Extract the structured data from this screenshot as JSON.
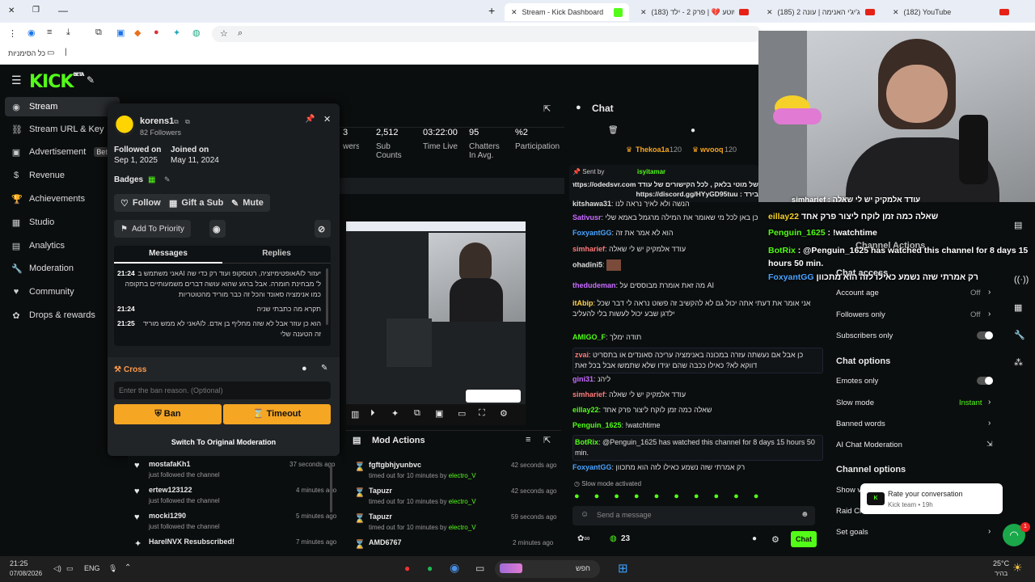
{
  "browser": {
    "tabs": [
      {
        "label": "(182) YouTube"
      },
      {
        "label": "(185) רונן ג'יג'י האנימה | עונה 2"
      },
      {
        "label": "(183) הפשוטע 💔 | פרק 2 - ילד"
      },
      {
        "label": "Stream - Kick Dashboard"
      }
    ],
    "bookmarks_label": "כל הסימניות"
  },
  "sidebar": {
    "items": [
      {
        "label": "Stream",
        "icon": "stream-icon"
      },
      {
        "label": "Stream URL & Key",
        "icon": "link-icon"
      },
      {
        "label": "Advertisement",
        "icon": "ad-icon"
      },
      {
        "label": "Revenue",
        "icon": "revenue-icon"
      },
      {
        "label": "Achievements",
        "icon": "trophy-icon"
      },
      {
        "label": "Studio",
        "icon": "studio-icon"
      },
      {
        "label": "Analytics",
        "icon": "analytics-icon"
      },
      {
        "label": "Moderation",
        "icon": "wrench-icon"
      },
      {
        "label": "Community",
        "icon": "community-icon"
      },
      {
        "label": "Drops & rewards",
        "icon": "gift-icon"
      }
    ],
    "badge": "Bet"
  },
  "stats": [
    {
      "value": "3",
      "label": "wers"
    },
    {
      "value": "2,512",
      "label": "Sub Counts"
    },
    {
      "value": "03:22:00",
      "label": "Time Live"
    },
    {
      "value": "95",
      "label": "Chatters In Avg."
    },
    {
      "value": "%2",
      "label": "Participation"
    }
  ],
  "user_card": {
    "username": "korens1",
    "followers": "82 Followers",
    "followed_on_label": "Followed on",
    "followed_on": "Sep 1, 2025",
    "joined_on_label": "Joined on",
    "joined_on": "May 11, 2024",
    "badges_label": "Badges",
    "follow": "Follow",
    "gift_sub": "Gift a Sub",
    "mute": "Mute",
    "add_priority": "Add To Priority",
    "tab_messages": "Messages",
    "tab_replies": "Replies",
    "messages": [
      {
        "time": "21:24",
        "text": "יעזור לAIאופטימיזציה, רטוסקופ ועוד רק כדי שה AIאני משתמש ב ל' מבחינת חומרה. אבל ברגע שהוא עושה דברים משמעותיים בתקופה כמו אנימציה סאונד והכל זה כבר מוריד מהטוטריות"
      },
      {
        "time": "21:24",
        "text": "תקרא מה כתבתי שניה"
      },
      {
        "time": "21:25",
        "text": "הוא כן עוזר אבל לא שזה מחליף בן אדם. לAIאני לא ממש מוריד זה הטענה שלי"
      }
    ],
    "cross_label": "Cross",
    "ban_reason_placeholder": "Enter the ban reason. (Optional)",
    "ban": "Ban",
    "timeout": "Timeout",
    "switch": "Switch To Original Moderation"
  },
  "recent_events": [
    {
      "name": "mostafaKh1",
      "sub": "just followed the channel",
      "time": "37 seconds ago"
    },
    {
      "name": "ertew123122",
      "sub": "just followed the channel",
      "time": "4 minutes ago"
    },
    {
      "name": "mocki1290",
      "sub": "just followed the channel",
      "time": "5 minutes ago"
    },
    {
      "name": "HarelNVX Resubscribed!",
      "sub": "",
      "time": "7 minutes ago"
    }
  ],
  "mod_actions": {
    "title": "Mod Actions",
    "rows": [
      {
        "name": "fgftgbhjyunbvc",
        "sub": "timed out for 10 minutes by",
        "by": "electro_V",
        "time": "42 seconds ago"
      },
      {
        "name": "Tapuzr",
        "sub": "timed out for 10 minutes by",
        "by": "electro_V",
        "time": "42 seconds ago"
      },
      {
        "name": "Tapuzr",
        "sub": "timed out for 10 minutes by",
        "by": "electro_V",
        "time": "59 seconds ago"
      },
      {
        "name": "AMD6767",
        "sub": "",
        "by": "",
        "time": "2 minutes ago"
      }
    ]
  },
  "chat": {
    "title": "Chat",
    "top_gifters": [
      {
        "name": "Thekoa1a",
        "count": "120"
      },
      {
        "name": "wvooq",
        "count": "120"
      }
    ],
    "pinned": {
      "sent_by": "Sent by",
      "user": "isyitamar",
      "line1": "של מוטי בלאק , לכל הקישורים של עודד https://odedsvr.com/",
      "line2": "בירד : https://discord.gg/HYyGD95tuu"
    },
    "messages": [
      {
        "user": "kitshawa31",
        "text": "הנשה ולא לאיך נראה לנו",
        "color": "#e0e0e0"
      },
      {
        "user": "Sativusr",
        "text": "כן באן לכל מי שאומר את המילה מרגמל באמא שלי",
        "color": "#c86bff"
      },
      {
        "user": "FoxyantGG",
        "text": "הוא לא אמר את זה",
        "color": "#4aa3ff"
      },
      {
        "user": "simharief",
        "text": "עודד אלמקיק יש לי שאלה",
        "color": "#ff7a7a"
      },
      {
        "user": "ohadini5",
        "text": "",
        "color": "#e0e0e0"
      },
      {
        "user": "thedudeman",
        "text": "מה זאת אומרת מבוססים על AI",
        "color": "#c86bff"
      },
      {
        "user": "itAbip",
        "text": "אני אומר את דעתי אתה יכול גם לא להקשיב זה פשוט נראה לי דבר שכל ילדגן שבע יכול לעשות בלי להעליב",
        "color": "#ffd24a"
      },
      {
        "user": "AMIGO_F",
        "text": "תודה ימלך",
        "color": "#53fc18"
      },
      {
        "user": "zvai",
        "text": "כן אבל אם נעשתה עזרה במכונה באנימציה עריכה סאונדים או בתסריט דווקא לא? כאילו ככבה שהם יגידו שלא שתמשו אבל בכל זאת",
        "color": "#ff7a7a"
      },
      {
        "user": "gini31",
        "text": "ליהנ",
        "color": "#c86bff"
      },
      {
        "user": "simharief",
        "text": "עודד אלמקיק יש לי שאלה",
        "color": "#ff7a7a"
      },
      {
        "user": "eillay22",
        "text": "שאלה כמה זמן לוקח ליצור פרק אחד",
        "color": "#53fc18"
      },
      {
        "user": "Penguin_1625",
        "text": "!watchtime",
        "color": "#53fc18"
      },
      {
        "user": "BotRix",
        "text": "@Penguin_1625 has watched this channel for 8 days 15 hours 50 min.",
        "color": "#53fc18"
      },
      {
        "user": "FoxyantGG",
        "text": "רק אמרתי שזה נשמע כאילו לזה הוא מתכוון",
        "color": "#4aa3ff"
      }
    ],
    "slow_mode": "Slow mode activated",
    "placeholder": "Send a message",
    "count": "23",
    "send": "Chat"
  },
  "channel_actions": {
    "title": "Channel Actions",
    "chat_access": "Chat access",
    "account_age": "Account age",
    "account_age_val": "Off",
    "followers_only": "Followers only",
    "followers_only_val": "Off",
    "subscribers_only": "Subscribers only",
    "chat_options": "Chat options",
    "emotes_only": "Emotes only",
    "slow_mode": "Slow mode",
    "slow_mode_val": "Instant",
    "banned_words": "Banned words",
    "ai_moderation": "AI Chat Moderation",
    "channel_options": "Channel options",
    "show_v": "Show v",
    "raid_cha": "Raid Cha",
    "set_goals": "Set goals"
  },
  "overlay": {
    "line1": "עודד אלמקיק יש לי שאלה : simharief",
    "line2a": "eillay22",
    "line2b": "שאלה כמה זמן לוקח ליצור פרק אחד",
    "line3a": "Penguin_1625",
    "line3b": ": !watchtime",
    "line4a": "BotRix",
    "line4b": ": @Penguin_1625 has watched this channel for 8 days 15 hours 50 min.",
    "line5a": "FoxyantGG",
    "line5b": "רק אמרתי שזה נשמע כאילו לזה הוא מתכוון"
  },
  "toast": {
    "title": "Rate your conversation",
    "sub": "Kick team • 19h",
    "badge": "1"
  },
  "taskbar": {
    "time": "21:25",
    "date": "07/08/2026",
    "lang": "ENG",
    "search": "חפש",
    "weather": "25°C",
    "weather_sub": "בהיר"
  }
}
